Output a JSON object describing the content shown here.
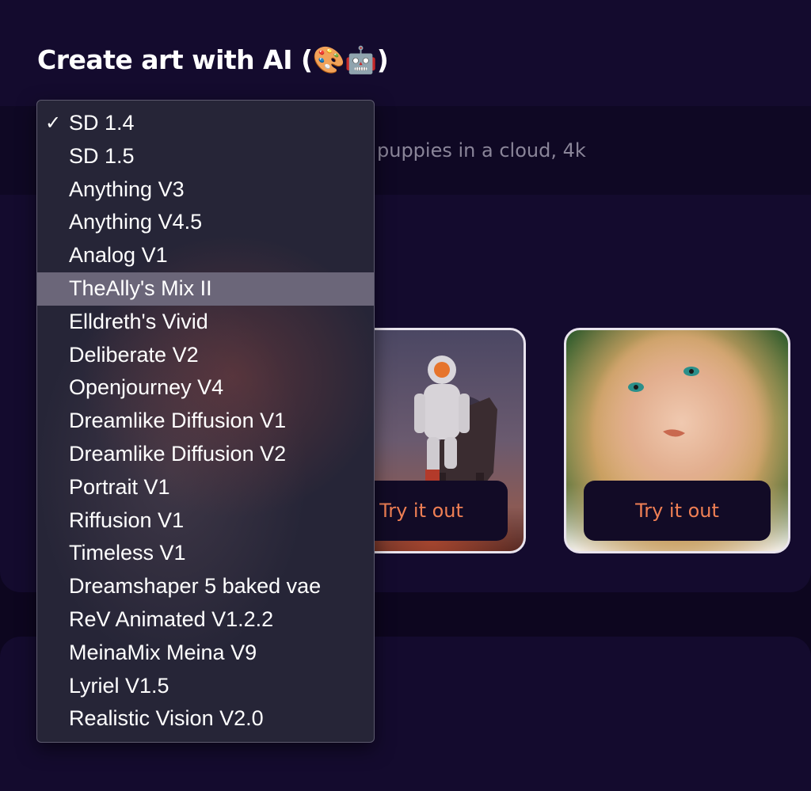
{
  "title": "Create art with AI (🎨🤖)",
  "prompt": {
    "text": "puppies in a cloud, 4k"
  },
  "cards": [
    {
      "button_label": "Try it out"
    },
    {
      "button_label": "Try it out"
    }
  ],
  "model_dropdown": {
    "selected": "SD 1.4",
    "highlighted": "TheAlly's Mix II",
    "options": [
      "SD 1.4",
      "SD 1.5",
      "Anything V3",
      "Anything V4.5",
      "Analog V1",
      "TheAlly's Mix II",
      "Elldreth's Vivid",
      "Deliberate V2",
      "Openjourney V4",
      "Dreamlike Diffusion V1",
      "Dreamlike Diffusion V2",
      "Portrait V1",
      "Riffusion V1",
      "Timeless V1",
      "Dreamshaper 5 baked vae",
      "ReV Animated V1.2.2",
      "MeinaMix Meina V9",
      "Lyriel V1.5",
      "Realistic Vision V2.0"
    ],
    "check_icon": "✓"
  },
  "colors": {
    "background": "#0d061f",
    "panel": "#140b2e",
    "accent": "#ef7f54",
    "menu": "#262537",
    "menu_highlight": "#6b6679"
  }
}
